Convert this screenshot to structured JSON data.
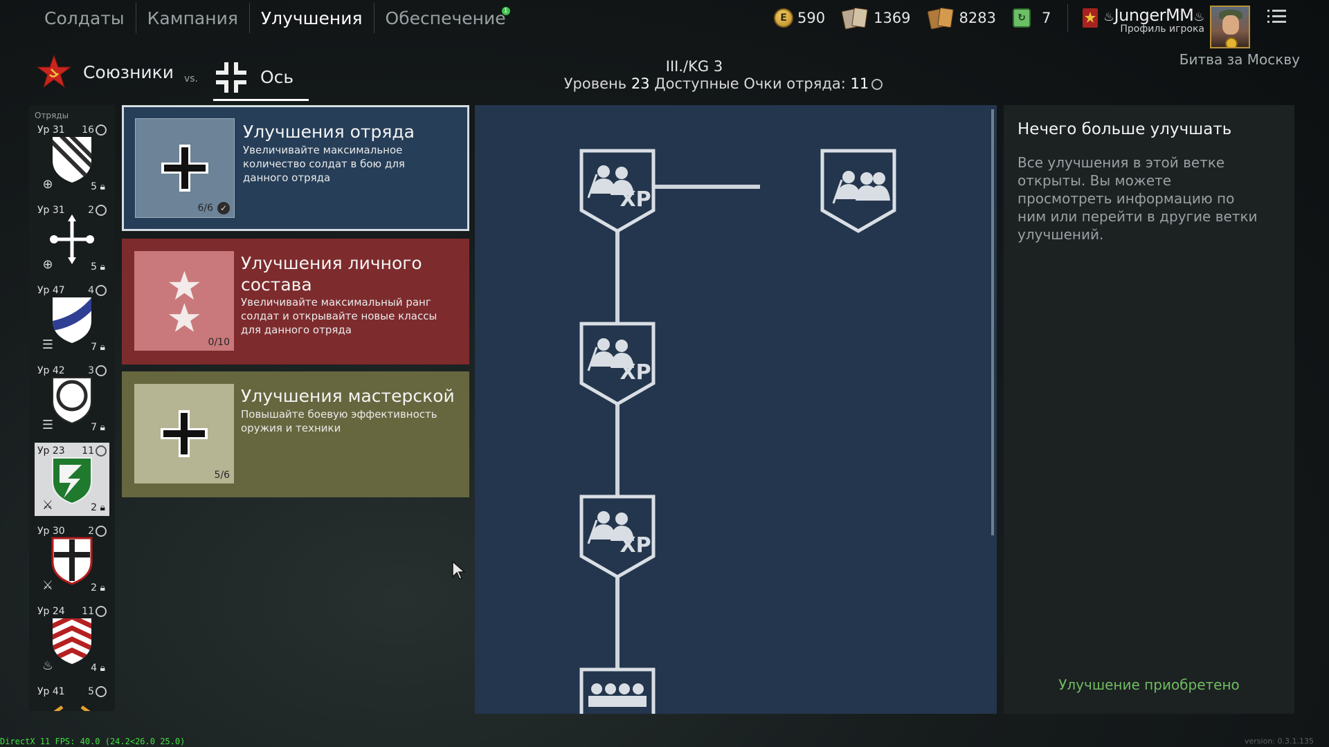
{
  "nav": {
    "tabs": [
      {
        "label": "Солдаты"
      },
      {
        "label": "Кампания"
      },
      {
        "label": "Улучшения"
      },
      {
        "label": "Обеспечение"
      }
    ],
    "notification_count": "1"
  },
  "currencies": {
    "gold": "590",
    "gold_symbol": "E",
    "silver_cards": "1369",
    "gold_cards": "8283",
    "tickets": "7"
  },
  "player": {
    "name": "JungerMM",
    "profile_label": "Профиль игрока",
    "battle": "Битва за Москву"
  },
  "factions": {
    "allies": "Союзники",
    "vs": "vs.",
    "axis": "Ось"
  },
  "squad_header": {
    "name": "III./KG 3",
    "level_prefix": "Уровень",
    "level": "23",
    "points_label": "Доступные Очки отряда:",
    "points": "11"
  },
  "squads": {
    "header": "Отряды",
    "items": [
      {
        "level": "Ур 31",
        "points": "16",
        "men": "5"
      },
      {
        "level": "Ур 31",
        "points": "2",
        "men": "5"
      },
      {
        "level": "Ур 47",
        "points": "4",
        "men": "7"
      },
      {
        "level": "Ур 42",
        "points": "3",
        "men": "7"
      },
      {
        "level": "Ур 23",
        "points": "11",
        "men": "2"
      },
      {
        "level": "Ур 30",
        "points": "2",
        "men": "2"
      },
      {
        "level": "Ур 24",
        "points": "11",
        "men": "4"
      },
      {
        "level": "Ур 41",
        "points": "5",
        "men": ""
      }
    ]
  },
  "cards": {
    "squad": {
      "title": "Улучшения отряда",
      "desc": "Увеличивайте максимальное количество солдат в бою для данного отряда",
      "count": "6/6"
    },
    "personnel": {
      "title": "Улучшения личного состава",
      "desc": "Увеличивайте максимальный ранг солдат и открывайте новые классы для данного отряда",
      "count": "0/10"
    },
    "workshop": {
      "title": "Улучшения мастерской",
      "desc": "Повышайте боевую эффективность оружия и техники",
      "count": "5/6"
    }
  },
  "tree": {
    "xp_label": "XP"
  },
  "info": {
    "title": "Нечего больше улучшать",
    "desc": "Все улучшения в этой ветке открыты. Вы можете просмотреть информацию по ним или перейти в другие ветки улучшений.",
    "status": "Улучшение приобретено"
  },
  "footer": {
    "fps": "DirectX 11 FPS: 40.0 (24.2<26.0 25.0)",
    "version": "version: 0.3.1.135"
  },
  "colors": {
    "squad_card": "#263e58",
    "personnel_card": "#7d2b2d",
    "workshop_card": "#67673f",
    "tree_bg": "#24364d",
    "status_green": "#6fbc5f"
  }
}
